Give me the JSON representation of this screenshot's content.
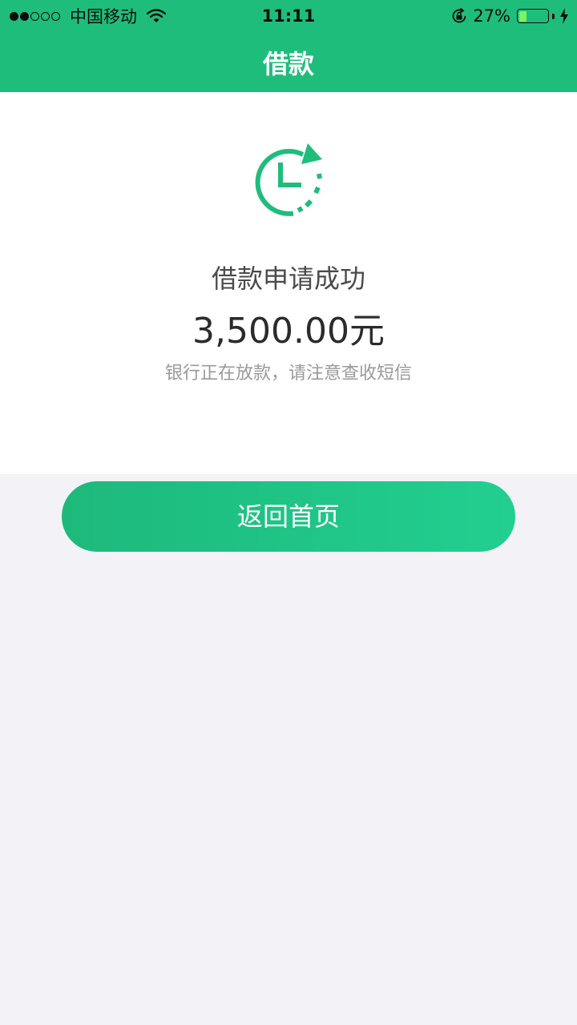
{
  "status_bar": {
    "carrier": "中国移动",
    "time": "11:11",
    "battery_percent": "27%",
    "battery_level": 0.27,
    "signal_bars_filled": 2,
    "signal_bars_total": 5,
    "icons": [
      "wifi-icon",
      "rotation-lock-icon",
      "charging-icon"
    ]
  },
  "nav": {
    "title": "借款"
  },
  "result": {
    "icon": "clock-refresh-icon",
    "title": "借款申请成功",
    "amount": "3,500.00元",
    "hint": "银行正在放款，请注意查收短信"
  },
  "actions": {
    "home_label": "返回首页"
  },
  "colors": {
    "primary": "#1fbd7c",
    "background": "#f2f2f7",
    "battery_fill": "#7ef261"
  }
}
